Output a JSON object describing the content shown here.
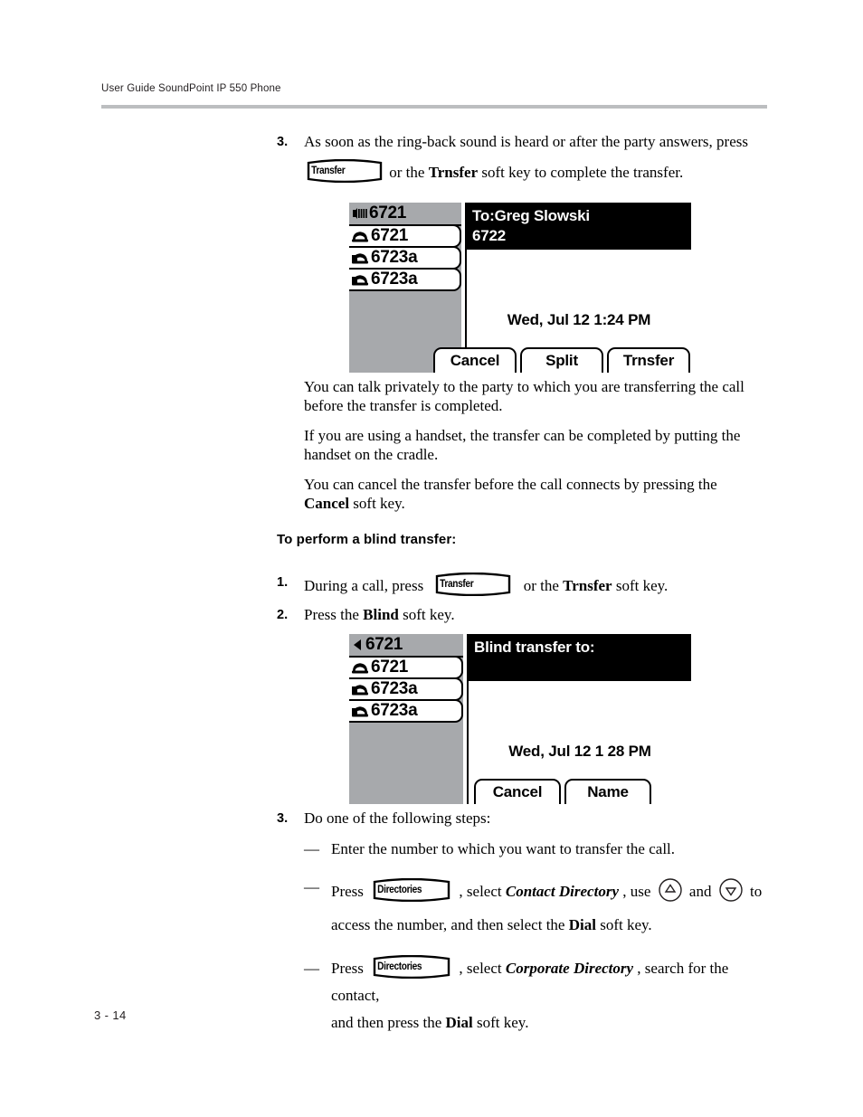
{
  "header": {
    "running_head": "User Guide SoundPoint IP 550 Phone"
  },
  "footer": {
    "page_number": "3 - 14"
  },
  "steps": {
    "step3_top": {
      "number": "3.",
      "text_before_key": "As soon as the ring-back sound is heard or after the party answers, press",
      "hardkey_label": "Transfer",
      "text_after_key_1": "or the",
      "bold_softkey": "Trnsfer",
      "text_after_key_2": "soft key to complete the transfer."
    },
    "paragraphs": [
      "You can talk privately to the party to which you are transferring the call before the transfer is completed.",
      "If you are using a handset, the transfer can be completed by putting the handset on the cradle."
    ],
    "cancel_paragraph": {
      "text_before": "You can cancel the transfer before the call connects by pressing the",
      "bold_word": "Cancel",
      "text_after": "soft key."
    }
  },
  "blind_section": {
    "heading": "To perform a blind transfer:",
    "step1": {
      "number": "1.",
      "text_before_key": "During a call, press",
      "hardkey_label": "Transfer",
      "text_mid": "or the",
      "bold_softkey": "Trnsfer",
      "text_after": "soft key."
    },
    "step2": {
      "number": "2.",
      "text_before": "Press the",
      "bold_word": "Blind",
      "text_after": "soft key."
    },
    "step3": {
      "number": "3.",
      "text": "Do one of the following steps:"
    },
    "bullets": [
      {
        "mark": "—",
        "text": "Enter the number to which you want to transfer the call."
      },
      {
        "mark": "—",
        "text_press": "Press",
        "hardkey_label": "Directories",
        "text_select": ", select",
        "italic_target": "Contact Directory",
        "text_use": ", use",
        "up_icon": "up-arrow-key-icon",
        "text_and": "and",
        "down_icon": "down-arrow-key-icon",
        "text_to": "to",
        "text_line2_before": "access the number, and then select the",
        "bold_word": "Dial",
        "text_line2_after": "soft key."
      },
      {
        "mark": "—",
        "text_press": "Press",
        "hardkey_label": "Directories",
        "text_select": ", select",
        "italic_target": "Corporate Directory",
        "text_after": ", search for the contact,",
        "text_line2_before": "and then press the",
        "bold_word": "Dial",
        "text_line2_after": "soft key."
      }
    ]
  },
  "phone_screen_1": {
    "lines": [
      {
        "label": "6721",
        "icon": "speaker-active-icon",
        "active": true
      },
      {
        "label": "6721",
        "icon": "handset-icon",
        "active": false
      },
      {
        "label": "6723a",
        "icon": "handset-icon",
        "active": false
      },
      {
        "label": "6723a",
        "icon": "handset-icon",
        "active": false
      }
    ],
    "banner_line1": "To:Greg Slowski",
    "banner_line2": "6722",
    "datetime": "Wed, Jul 12  1:24 PM",
    "softkeys": [
      "Cancel",
      "Split",
      "Trnsfer"
    ]
  },
  "phone_screen_2": {
    "lines": [
      {
        "label": "6721",
        "icon": "back-arrow-icon",
        "active": true
      },
      {
        "label": "6721",
        "icon": "handset-icon",
        "active": false
      },
      {
        "label": "6723a",
        "icon": "handset-icon",
        "active": false
      },
      {
        "label": "6723a",
        "icon": "handset-icon",
        "active": false
      }
    ],
    "banner_line1": "Blind transfer to:",
    "banner_line2": "",
    "datetime": "Wed, Jul 12  1 28 PM",
    "softkeys": [
      "Cancel",
      "Name"
    ]
  },
  "colors": {
    "lcd_gray": "#a7a9ac",
    "rule_gray": "#bcbec0",
    "ink": "#000000"
  }
}
